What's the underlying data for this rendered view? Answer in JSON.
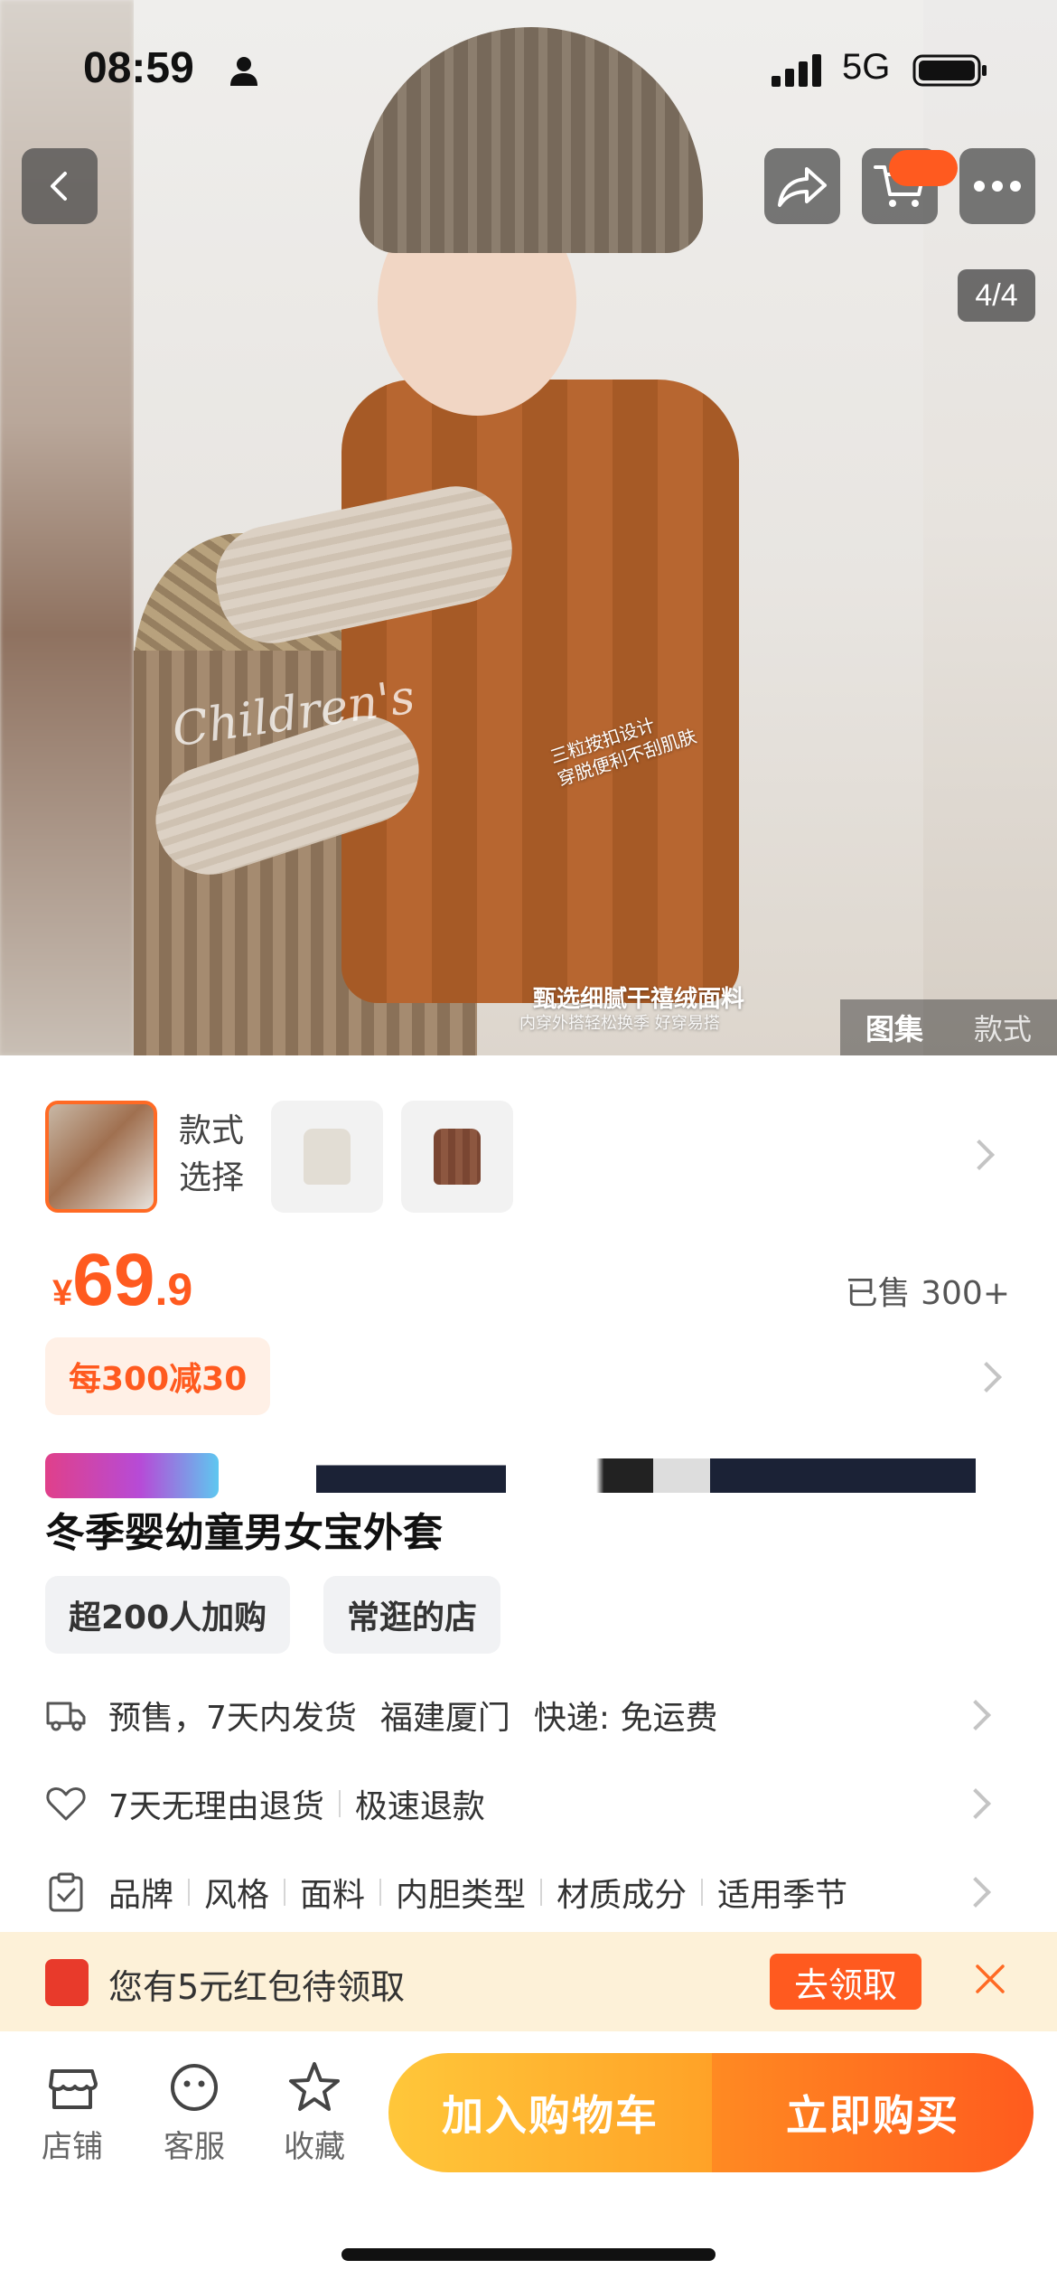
{
  "status_bar": {
    "time": "08:59",
    "network": "5G"
  },
  "gallery": {
    "counter": "4/4",
    "tabs": [
      "图集",
      "款式"
    ],
    "watermark": "Children's",
    "overlay_note_1": "三粒按扣设计",
    "overlay_note_2": "穿脱便利不刮肌肤",
    "overlay_title": "甄选细腻干禧绒面料",
    "overlay_sub": "内穿外搭轻松换季 好穿易搭"
  },
  "sku": {
    "label_line1": "款式",
    "label_line2": "选择"
  },
  "price": {
    "symbol": "¥",
    "integer": "69",
    "decimal": ".9",
    "sold": "已售 300+"
  },
  "promo": {
    "label": "每300减30"
  },
  "product": {
    "title": "冬季婴幼童男女宝外套"
  },
  "tags": [
    "超200人加购",
    "常逛的店"
  ],
  "info": {
    "shipping": [
      "预售，7天内发货",
      "福建厦门",
      "快递: 免运费"
    ],
    "returns": [
      "7天无理由退货",
      "极速退款"
    ],
    "attributes": [
      "品牌",
      "风格",
      "面料",
      "内胆类型",
      "材质成分",
      "适用季节"
    ]
  },
  "coupon": {
    "text": "您有5元红包待领取",
    "button": "去领取"
  },
  "bottom_bar": {
    "store": "店铺",
    "service": "客服",
    "favorite": "收藏",
    "add_to_cart": "加入购物车",
    "buy_now": "立即购买"
  },
  "colors": {
    "accent": "#ff5a1f",
    "cart_cta": "#ffb12f",
    "coupon_bg": "#fdf1d8"
  }
}
